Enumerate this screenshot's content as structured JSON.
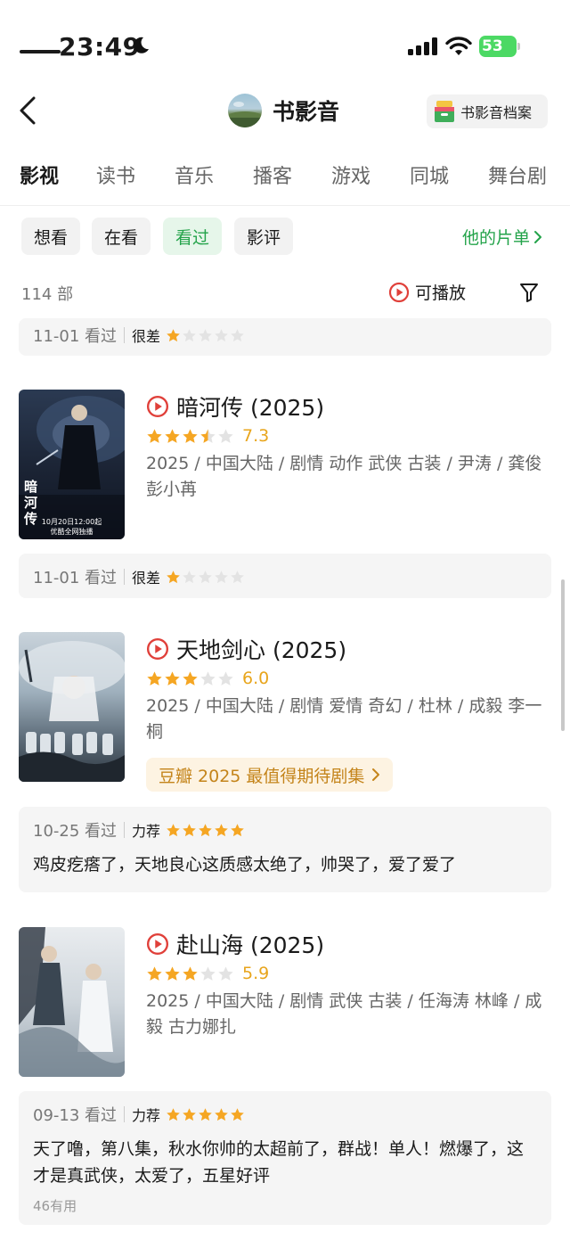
{
  "status_bar": {
    "time": "23:49",
    "battery": "53"
  },
  "nav": {
    "title": "书影音",
    "archive_label": "书影音档案"
  },
  "tabs": [
    {
      "label": "影视",
      "active": true
    },
    {
      "label": "读书"
    },
    {
      "label": "音乐"
    },
    {
      "label": "播客"
    },
    {
      "label": "游戏"
    },
    {
      "label": "同城"
    },
    {
      "label": "舞台剧"
    }
  ],
  "filters": {
    "chips": [
      {
        "label": "想看"
      },
      {
        "label": "在看"
      },
      {
        "label": "看过",
        "active": true
      },
      {
        "label": "影评"
      }
    ],
    "his_list": "他的片单"
  },
  "list_header": {
    "count": "114 部",
    "playable": "可播放"
  },
  "reviews": [
    {
      "date": "11-01 看过",
      "level": "很差",
      "stars": 1
    },
    {
      "date": "11-01 看过",
      "level": "很差",
      "stars": 1
    },
    {
      "date": "10-25 看过",
      "level": "力荐",
      "stars": 5,
      "text": "鸡皮疙瘩了，天地良心这质感太绝了，帅哭了，爱了爱了"
    },
    {
      "date": "09-13 看过",
      "level": "力荐",
      "stars": 5,
      "text": "天了噜，第八集，秋水你帅的太超前了，群战！单人！燃爆了，这才是真武侠，太爱了，五星好评",
      "useful": "46有用"
    }
  ],
  "movies": [
    {
      "title": "暗河传 (2025)",
      "rating": 3.5,
      "score": "7.3",
      "meta": "2025 / 中国大陆 / 剧情 动作 武侠 古装 / 尹涛 / 龚俊 彭小苒",
      "poster_text": "暗河传",
      "poster_caption_1": "10月20日12:00起",
      "poster_caption_2": "优酷全网独播"
    },
    {
      "title": "天地剑心 (2025)",
      "rating": 3,
      "score": "6.0",
      "meta": "2025 / 中国大陆 / 剧情 爱情 奇幻 / 杜林 / 成毅 李一桐",
      "badge": "豆瓣 2025 最值得期待剧集"
    },
    {
      "title": "赴山海 (2025)",
      "rating": 3,
      "score": "5.9",
      "meta": "2025 / 中国大陆 / 剧情 武侠 古装 / 任海涛 林峰 / 成毅 古力娜扎"
    }
  ],
  "colors": {
    "green": "#23a34a",
    "star": "#f5a623",
    "play_red": "#e0403a",
    "badge_text": "#c4841a"
  }
}
